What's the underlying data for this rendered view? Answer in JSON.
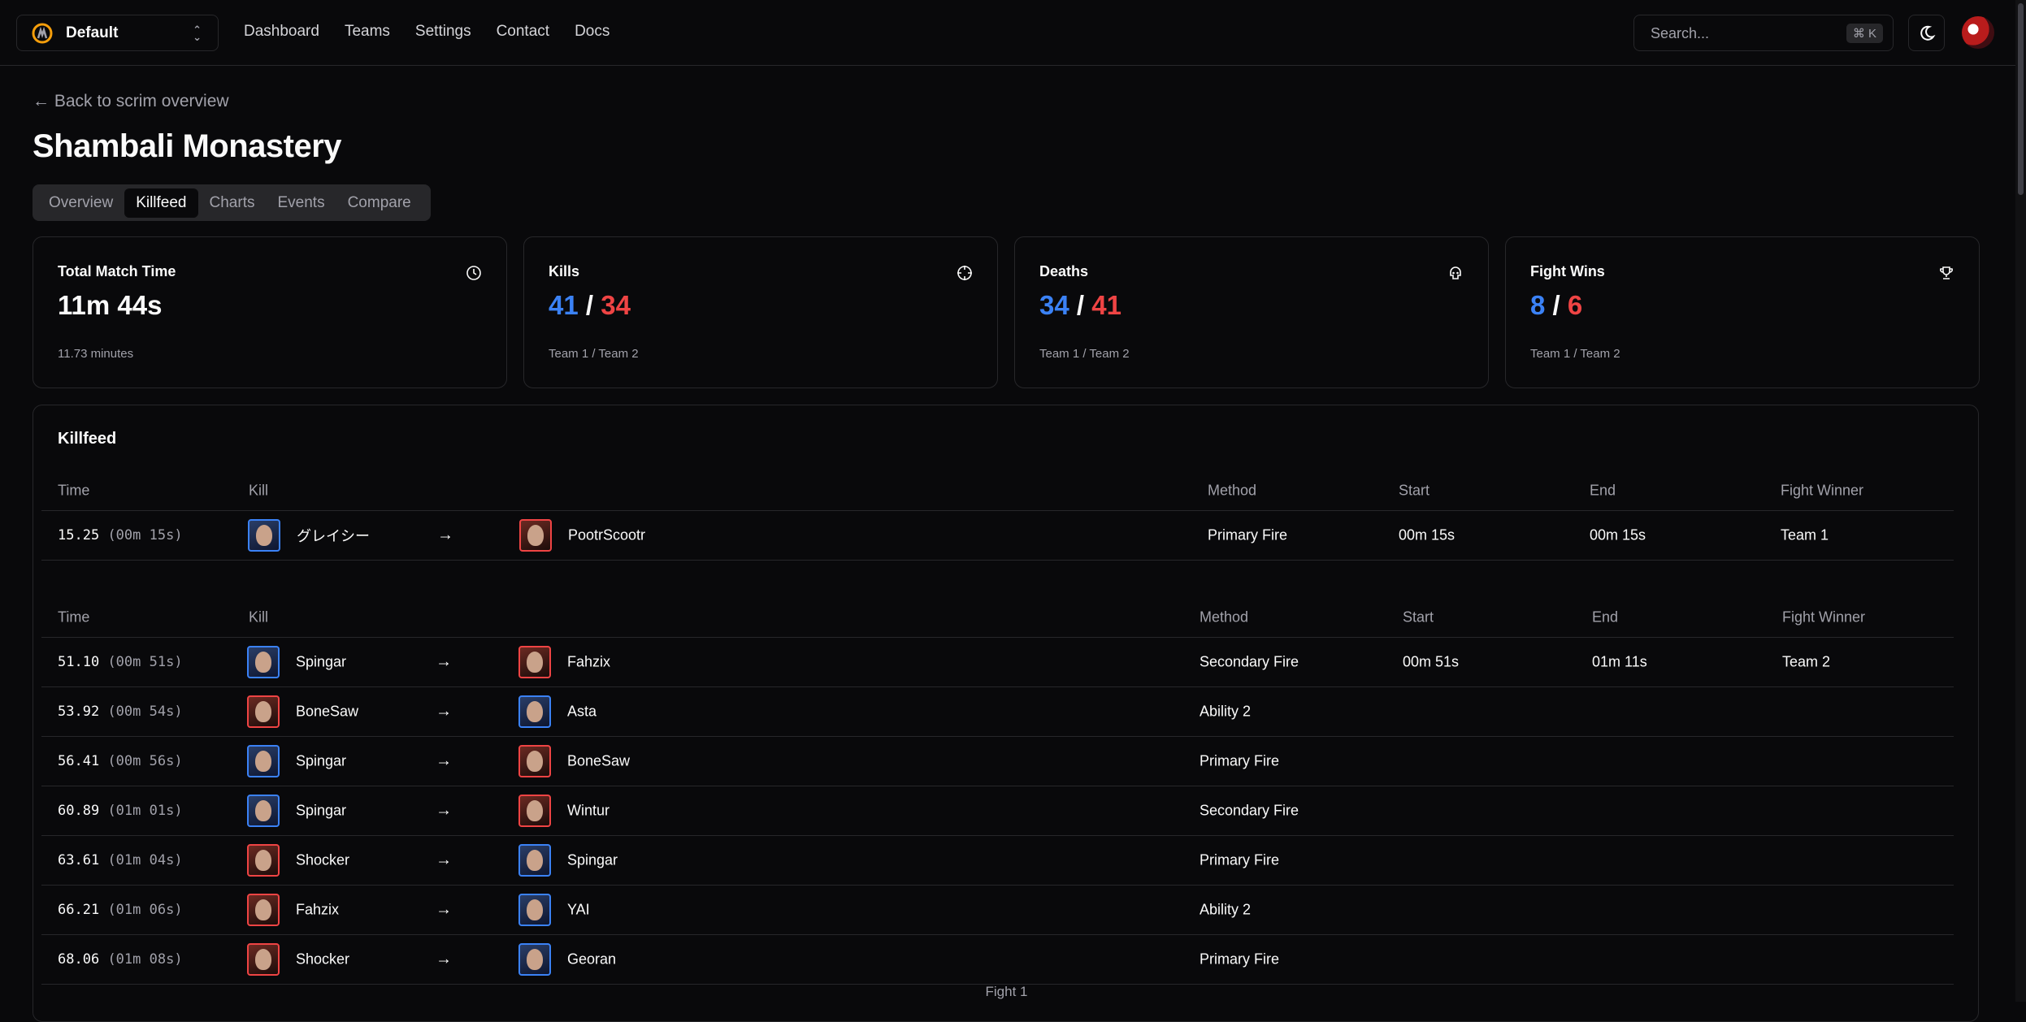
{
  "header": {
    "team": "Default",
    "nav": [
      "Dashboard",
      "Teams",
      "Settings",
      "Contact",
      "Docs"
    ],
    "search_placeholder": "Search...",
    "search_kbd": "⌘ K"
  },
  "page": {
    "back_link": "← Back to scrim overview",
    "title": "Shambali Monastery",
    "tabs": [
      "Overview",
      "Killfeed",
      "Charts",
      "Events",
      "Compare"
    ],
    "active_tab": "Killfeed"
  },
  "cards": [
    {
      "label": "Total Match Time",
      "value": "11m 44s",
      "sub": "11.73 minutes",
      "icon": "clock-icon"
    },
    {
      "label": "Kills",
      "team1": "41",
      "sep": " / ",
      "team2": "34",
      "sub": "Team 1 / Team 2",
      "icon": "crosshair-icon"
    },
    {
      "label": "Deaths",
      "team1": "34",
      "sep": " / ",
      "team2": "41",
      "sub": "Team 1 / Team 2",
      "icon": "skull-icon"
    },
    {
      "label": "Fight Wins",
      "team1": "8",
      "sep": " / ",
      "team2": "6",
      "sub": "Team 1 / Team 2",
      "icon": "trophy-icon"
    }
  ],
  "killfeed": {
    "title": "Killfeed",
    "headers": {
      "time": "Time",
      "kill": "Kill",
      "method": "Method",
      "start": "Start",
      "end": "End",
      "winner": "Fight Winner"
    },
    "fight0": [
      {
        "time": "15.25",
        "time_fmt": "(00m 15s)",
        "killer": "グレイシー",
        "killer_team": 1,
        "victim": "PootrScootr",
        "victim_team": 2,
        "method": "Primary Fire",
        "start": "00m 15s",
        "end": "00m 15s",
        "winner": "Team 1"
      }
    ],
    "fight1_label": "Fight 1",
    "fight1": [
      {
        "time": "51.10",
        "time_fmt": "(00m 51s)",
        "killer": "Spingar",
        "killer_team": 1,
        "victim": "Fahzix",
        "victim_team": 2,
        "method": "Secondary Fire",
        "start": "00m 51s",
        "end": "01m 11s",
        "winner": "Team 2"
      },
      {
        "time": "53.92",
        "time_fmt": "(00m 54s)",
        "killer": "BoneSaw",
        "killer_team": 2,
        "victim": "Asta",
        "victim_team": 1,
        "method": "Ability 2",
        "start": "",
        "end": "",
        "winner": ""
      },
      {
        "time": "56.41",
        "time_fmt": "(00m 56s)",
        "killer": "Spingar",
        "killer_team": 1,
        "victim": "BoneSaw",
        "victim_team": 2,
        "method": "Primary Fire",
        "start": "",
        "end": "",
        "winner": ""
      },
      {
        "time": "60.89",
        "time_fmt": "(01m 01s)",
        "killer": "Spingar",
        "killer_team": 1,
        "victim": "Wintur",
        "victim_team": 2,
        "method": "Secondary Fire",
        "start": "",
        "end": "",
        "winner": ""
      },
      {
        "time": "63.61",
        "time_fmt": "(01m 04s)",
        "killer": "Shocker",
        "killer_team": 2,
        "victim": "Spingar",
        "victim_team": 1,
        "method": "Primary Fire",
        "start": "",
        "end": "",
        "winner": ""
      },
      {
        "time": "66.21",
        "time_fmt": "(01m 06s)",
        "killer": "Fahzix",
        "killer_team": 2,
        "victim": "YAI",
        "victim_team": 1,
        "method": "Ability 2",
        "start": "",
        "end": "",
        "winner": ""
      },
      {
        "time": "68.06",
        "time_fmt": "(01m 08s)",
        "killer": "Shocker",
        "killer_team": 2,
        "victim": "Georan",
        "victim_team": 1,
        "method": "Primary Fire",
        "start": "",
        "end": "",
        "winner": ""
      }
    ]
  }
}
